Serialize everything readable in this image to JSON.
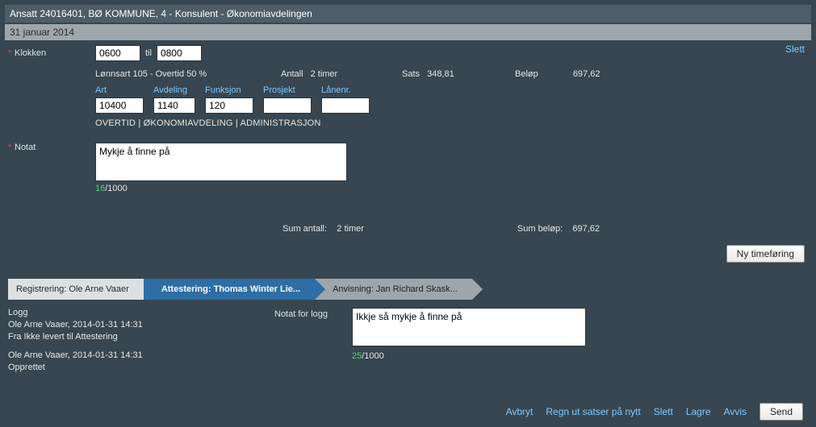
{
  "header": {
    "title": "Ansatt 24016401, BØ KOMMUNE, 4 - Konsulent - Økonomiavdelingen"
  },
  "date_bar": "31 januar 2014",
  "slett_link": "Slett",
  "klokken": {
    "label": "Klokken",
    "from": "0600",
    "til_label": "til",
    "to": "0800"
  },
  "lonnsart_line": "Lønnsart 105 - Overtid 50 %",
  "info": {
    "antall_label": "Antall",
    "antall_value": "2 timer",
    "sats_label": "Sats",
    "sats_value": "348,81",
    "belop_label": "Beløp",
    "belop_value": "697,62"
  },
  "cols": {
    "art": {
      "label": "Art",
      "value": "10400"
    },
    "avdeling": {
      "label": "Avdeling",
      "value": "1140"
    },
    "funksjon": {
      "label": "Funksjon",
      "value": "120"
    },
    "prosjekt": {
      "label": "Prosjekt",
      "value": ""
    },
    "lanenr": {
      "label": "Lånenr.",
      "value": ""
    }
  },
  "desc_line": "OVERTID | ØKONOMIAVDELING | ADMINISTRASJON",
  "notat": {
    "label": "Notat",
    "value": "Mykje å finne på",
    "count_cur": "16",
    "count_max": "/1000"
  },
  "sum": {
    "antall_label": "Sum antall:",
    "antall_value": "2 timer",
    "belop_label": "Sum beløp:",
    "belop_value": "697,62"
  },
  "ny_btn": "Ny timeføring",
  "workflow": {
    "step1": "Registrering: Ole Arne Vaaer",
    "step2": "Attestering: Thomas Winter Lie...",
    "step3": "Anvisning: Jan Richard Skask..."
  },
  "log": {
    "heading": "Logg",
    "e1_line1": "Ole Arne Vaaer, 2014-01-31 14:31",
    "e1_line2": "Fra Ikke levert til Attestering",
    "e2_line1": "Ole Arne Vaaer, 2014-01-31 14:31",
    "e2_line2": "Opprettet",
    "notat_label": "Notat for logg",
    "notat_value": "Ikkje så mykje å finne på",
    "count_cur": "25",
    "count_max": "/1000"
  },
  "actions": {
    "avbryt": "Avbryt",
    "regn": "Regn ut satser på nytt",
    "slett": "Slett",
    "lagre": "Lagre",
    "avvis": "Avvis",
    "send": "Send"
  }
}
